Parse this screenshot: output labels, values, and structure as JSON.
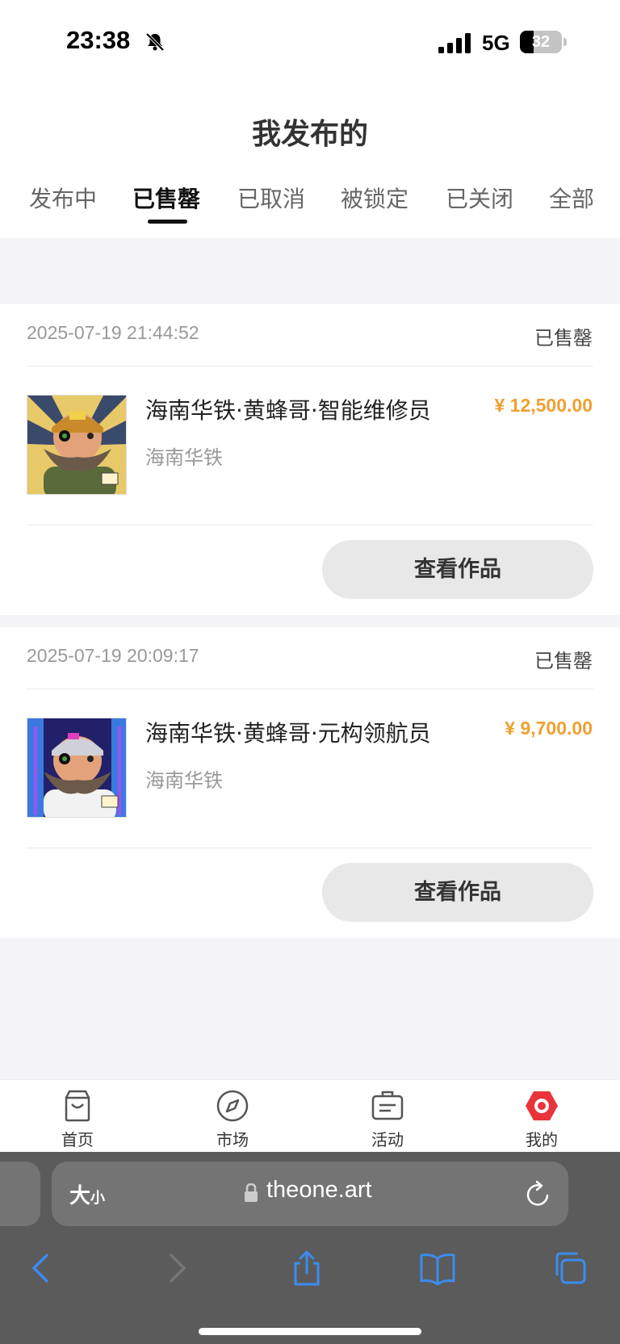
{
  "status_bar": {
    "time": "23:38",
    "network": "5G",
    "battery_level": "32",
    "battery_fraction": 0.32
  },
  "header": {
    "title": "我发布的"
  },
  "tabs": [
    {
      "label": "发布中",
      "active": false
    },
    {
      "label": "已售罄",
      "active": true
    },
    {
      "label": "已取消",
      "active": false
    },
    {
      "label": "被锁定",
      "active": false
    },
    {
      "label": "已关闭",
      "active": false
    },
    {
      "label": "全部",
      "active": false
    }
  ],
  "orders": [
    {
      "timestamp": "2025-07-19 21:44:52",
      "status": "已售罄",
      "title": "海南华铁·黄蜂哥·智能维修员",
      "publisher": "海南华铁",
      "price": "¥ 12,500.00",
      "button_label": "查看作品",
      "thumb_icon": "mechanic-avatar"
    },
    {
      "timestamp": "2025-07-19 20:09:17",
      "status": "已售罄",
      "title": "海南华铁·黄蜂哥·元构领航员",
      "publisher": "海南华铁",
      "price": "¥ 9,700.00",
      "button_label": "查看作品",
      "thumb_icon": "navigator-avatar"
    }
  ],
  "bottom_nav": [
    {
      "label": "首页",
      "icon": "bag-icon"
    },
    {
      "label": "市场",
      "icon": "compass-icon"
    },
    {
      "label": "活动",
      "icon": "ticket-icon"
    },
    {
      "label": "我的",
      "icon": "profile-icon",
      "active": true
    }
  ],
  "browser": {
    "aa_label": "大",
    "aa_small": "小",
    "url": "theone.art"
  },
  "colors": {
    "price": "#f0a030",
    "active_nav": "#e8343a",
    "toolbar_icon": "#3b8cf0"
  }
}
